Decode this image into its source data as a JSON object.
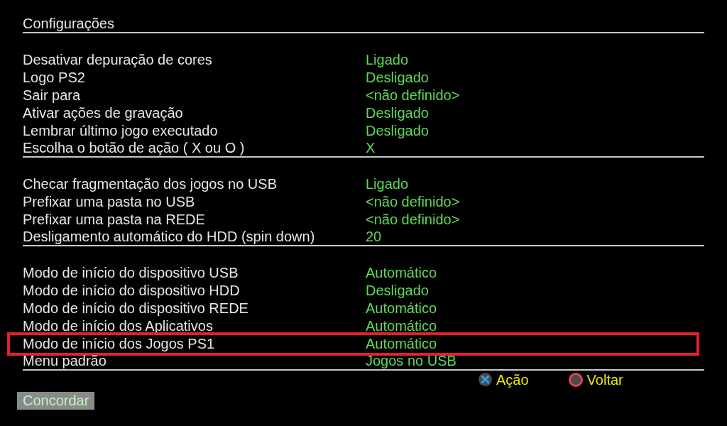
{
  "title": "Configurações",
  "sections": [
    {
      "rows": [
        {
          "label": "Desativar depuração de cores",
          "value": "Ligado",
          "outlined": false
        },
        {
          "label": "Logo PS2",
          "value": "Desligado",
          "outlined": false
        },
        {
          "label": "Sair para",
          "value": "<não definido>",
          "outlined": false
        },
        {
          "label": "Ativar ações de gravação",
          "value": "Desligado",
          "outlined": false
        },
        {
          "label": "Lembrar último jogo executado",
          "value": "Desligado",
          "outlined": false
        },
        {
          "label": "Escolha o botão de ação ( X ou O )",
          "value": "X",
          "outlined": false
        }
      ]
    },
    {
      "rows": [
        {
          "label": "Checar fragmentação dos jogos no USB",
          "value": "Ligado",
          "outlined": false
        },
        {
          "label": "Prefixar uma pasta no USB",
          "value": "<não definido>",
          "outlined": false
        },
        {
          "label": "Prefixar uma pasta na REDE",
          "value": "<não definido>",
          "outlined": false
        },
        {
          "label": "Desligamento automático do HDD (spin down)",
          "value": "20",
          "outlined": false
        }
      ]
    },
    {
      "rows": [
        {
          "label": "Modo de início do dispositivo USB",
          "value": "Automático",
          "outlined": false
        },
        {
          "label": "Modo de início do dispositivo HDD",
          "value": "Desligado",
          "outlined": false
        },
        {
          "label": "Modo de início do dispositivo REDE",
          "value": "Automático",
          "outlined": false
        },
        {
          "label": "Modo de início dos Aplicativos",
          "value": "Automático",
          "outlined": false
        },
        {
          "label": "Modo de início dos Jogos PS1",
          "value": "Automático",
          "outlined": true
        },
        {
          "label": "Menu padrão",
          "value": "Jogos no USB",
          "outlined": false
        }
      ]
    }
  ],
  "hints": [
    {
      "kind": "cross",
      "label": "Ação"
    },
    {
      "kind": "circle",
      "label": "Voltar"
    }
  ],
  "button": "Concordar"
}
